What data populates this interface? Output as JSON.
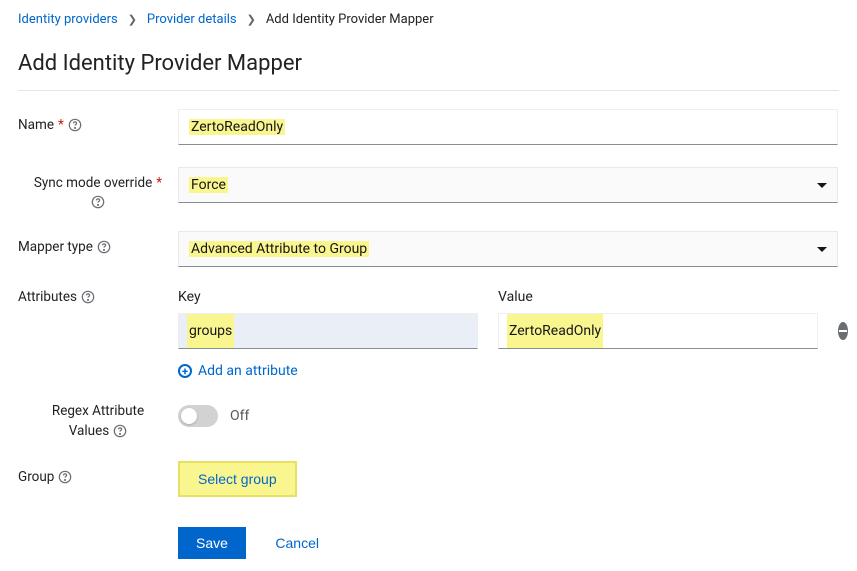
{
  "breadcrumb": {
    "items": [
      "Identity providers",
      "Provider details"
    ],
    "current": "Add Identity Provider Mapper"
  },
  "page_title": "Add Identity Provider Mapper",
  "fields": {
    "name": {
      "label": "Name",
      "value": "ZertoReadOnly"
    },
    "sync_mode": {
      "label": "Sync mode override",
      "value": "Force"
    },
    "mapper_type": {
      "label": "Mapper type",
      "value": "Advanced Attribute to Group"
    },
    "attributes": {
      "label": "Attributes",
      "key_header": "Key",
      "value_header": "Value",
      "rows": [
        {
          "key": "groups",
          "value": "ZertoReadOnly"
        }
      ],
      "add_label": "Add an attribute"
    },
    "regex": {
      "label_line1": "Regex Attribute",
      "label_line2": "Values",
      "state_label": "Off",
      "on": false
    },
    "group": {
      "label": "Group",
      "button": "Select group"
    }
  },
  "actions": {
    "save": "Save",
    "cancel": "Cancel"
  }
}
